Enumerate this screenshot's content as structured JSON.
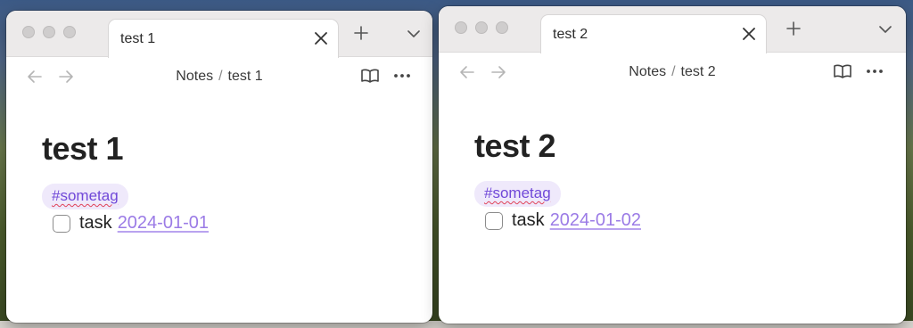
{
  "windows": [
    {
      "tab_title": "test 1",
      "breadcrumb": {
        "folder": "Notes",
        "separator": "/",
        "note": "test 1"
      },
      "note": {
        "title": "test 1",
        "tag": "#sometag",
        "task": {
          "label": "task",
          "date": "2024-01-01",
          "checked": false
        }
      }
    },
    {
      "tab_title": "test 2",
      "breadcrumb": {
        "folder": "Notes",
        "separator": "/",
        "note": "test 2"
      },
      "note": {
        "title": "test 2",
        "tag": "#sometag",
        "task": {
          "label": "task",
          "date": "2024-01-02",
          "checked": false
        }
      }
    }
  ],
  "icons": {
    "close": "close-icon",
    "new_tab": "plus-icon",
    "tab_list": "chevron-down-icon",
    "back": "arrow-left-icon",
    "forward": "arrow-right-icon",
    "reading_view": "book-icon",
    "more": "more-options-icon"
  },
  "colors": {
    "tag_background": "#efe9fb",
    "tag_text": "#7048d8",
    "date_link": "#9b7be6",
    "spellcheck_underline": "#e0445a"
  }
}
